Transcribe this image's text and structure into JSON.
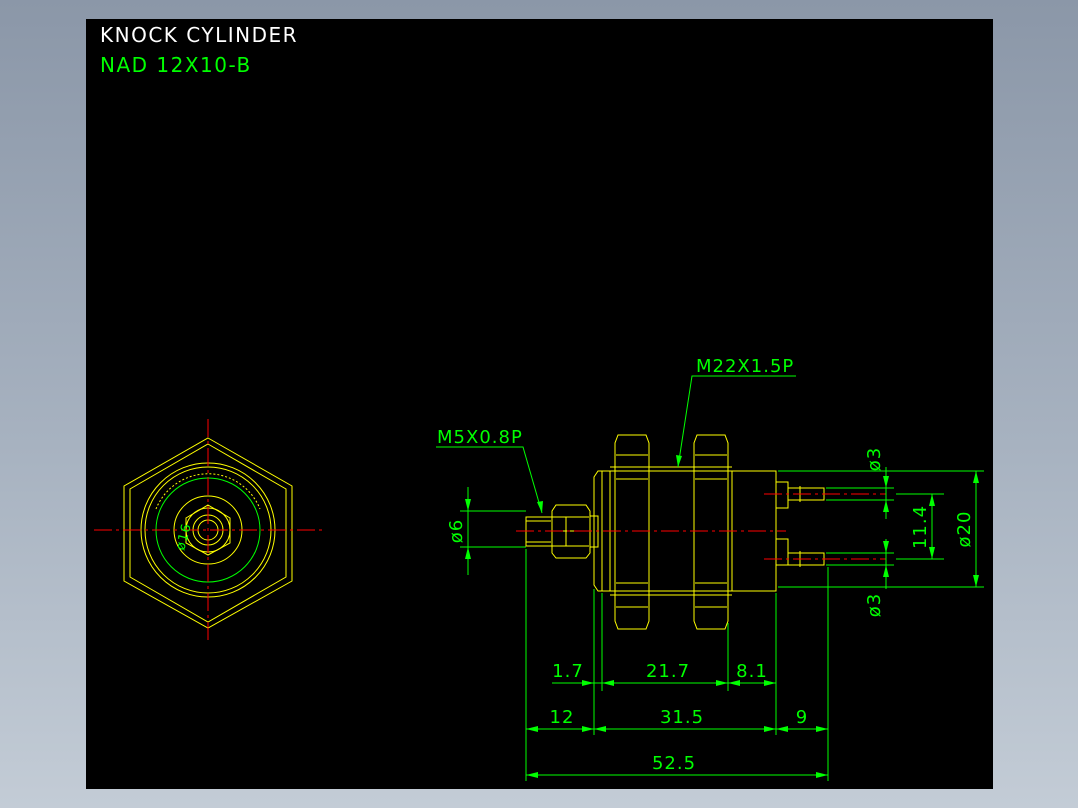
{
  "drawing": {
    "title": "KNOCK CYLINDER",
    "model": "NAD 12X10-B"
  },
  "labels": {
    "thread_main": "M22X1.5P",
    "thread_rod": "M5X0.8P",
    "rod_dia": "ø6",
    "port_dia_top": "ø3",
    "port_dia_bottom": "ø3",
    "port_spacing": "11.4",
    "body_dia": "ø20",
    "end_view_dia": "ø16"
  },
  "dimensions": {
    "row1": [
      "1.7",
      "21.7",
      "8.1"
    ],
    "row2": [
      "12",
      "31.5",
      "9"
    ],
    "overall": "52.5"
  },
  "colors": {
    "background": "#000000",
    "outline": "#ffff00",
    "dimension": "#00ff00",
    "centerline": "#ff0000",
    "title": "#ffffff",
    "model": "#00ff00"
  }
}
